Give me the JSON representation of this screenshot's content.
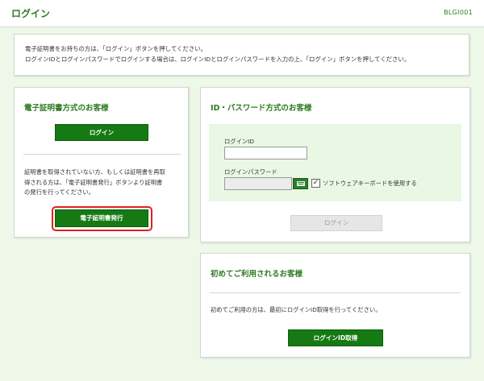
{
  "header": {
    "title": "ログイン",
    "code": "BLGI001"
  },
  "notice": {
    "line1": "電子証明書をお持ちの方は、「ログイン」ボタンを押してください。",
    "line2": "ログインIDとログインパスワードでログインする場合は、ログインIDとログインパスワードを入力の上、「ログイン」ボタンを押してください。"
  },
  "cert_panel": {
    "heading": "電子証明書方式のお客様",
    "login_button": "ログイン",
    "description_lines": [
      "証明書を取得されていない方、もしくは証明書を再取",
      "得される方は、「電子証明書発行」ボタンより証明書",
      "の発行を行ってください。"
    ],
    "issue_button": "電子証明書発行"
  },
  "idpw_panel": {
    "heading": "ID・パスワード方式のお客様",
    "login_id_label": "ログインID",
    "login_id_value": "",
    "password_label": "ログインパスワード",
    "password_value": "",
    "software_keyboard_label": "ソフトウェアキーボードを使用する",
    "software_keyboard_checked": true,
    "login_button": "ログイン"
  },
  "first_panel": {
    "heading": "初めてご利用されるお客様",
    "description": "初めてご利用の方は、最初にログインID取得を行ってください。",
    "get_id_button": "ログインID取得"
  },
  "icons": {
    "keyboard": "keyboard-icon",
    "checkbox": "checkmark-icon"
  },
  "colors": {
    "brand_green": "#2f7b23",
    "button_green": "#157a13",
    "highlight_red": "#e0201f",
    "background": "#edf8e8"
  }
}
